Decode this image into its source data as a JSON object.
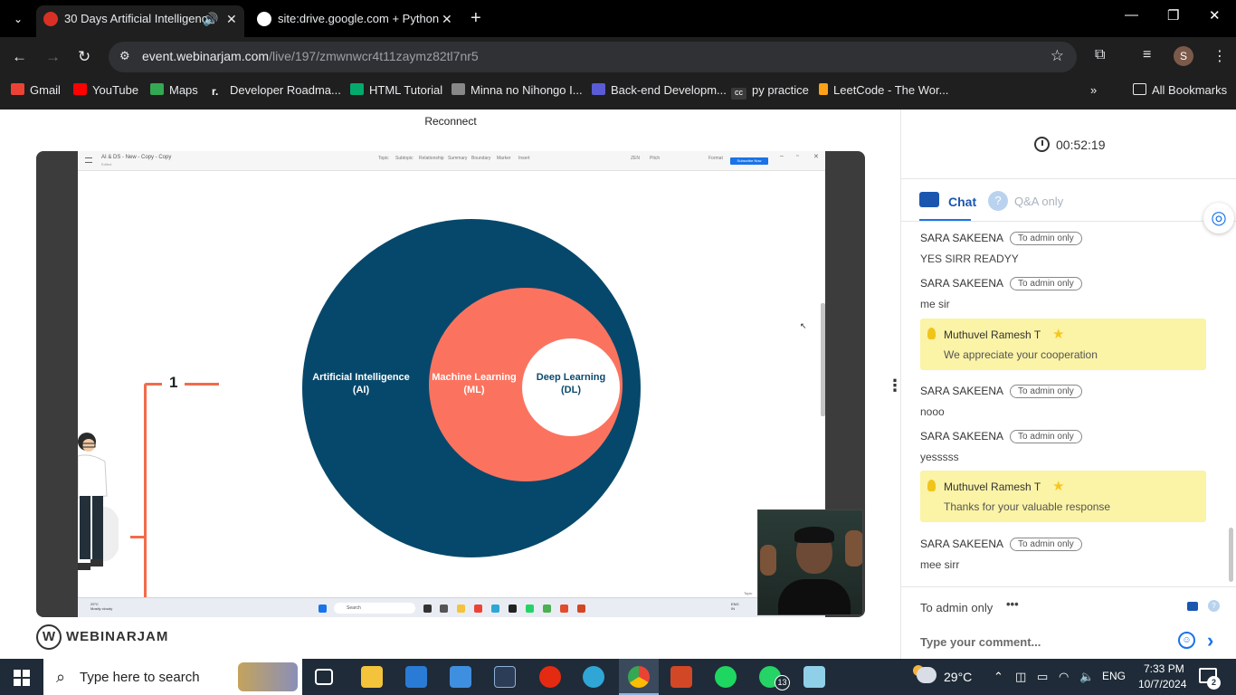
{
  "browser": {
    "tabs": [
      {
        "title": "30 Days Artificial Intelligenc",
        "favicon_color": "#d93025",
        "active": true
      },
      {
        "title": "site:drive.google.com + Python",
        "favicon_color": "#4285f4",
        "active": false
      }
    ],
    "new_tab": "+",
    "url_host": "event.webinarjam.com",
    "url_path": "/live/197/zmwnwcr4t11zaymz82tl7nr5",
    "avatar_letter": "S",
    "bookmarks": [
      {
        "label": "Gmail",
        "color": "#ea4335"
      },
      {
        "label": "YouTube",
        "color": "#ff0000"
      },
      {
        "label": "Maps",
        "color": "#34a853"
      },
      {
        "label": "Developer Roadma...",
        "color": "#e8eaed"
      },
      {
        "label": "HTML Tutorial",
        "color": "#04aa6d"
      },
      {
        "label": "Minna no Nihongo I...",
        "color": "#888888"
      },
      {
        "label": "Back-end Developm...",
        "color": "#5b5bd6"
      },
      {
        "label": "py practice",
        "color": "#e8eaed"
      },
      {
        "label": "LeetCode - The Wor...",
        "color": "#ffa116"
      }
    ],
    "all_bookmarks": "All Bookmarks"
  },
  "webinar": {
    "reconnect_label": "Reconnect",
    "shared_screen": {
      "doc_title": "AI & DS - New - Copy - Copy",
      "doc_sub": "Edited",
      "toolbar": [
        "Topic",
        "Subtopic",
        "Relationship",
        "Summary",
        "Boundary",
        "Marker",
        "Insert"
      ],
      "zen": "ZEN",
      "pitch": "Pitch",
      "format": "Format",
      "subscribe": "Subscribe Now",
      "step_number": "1",
      "venn": {
        "outer": {
          "label": "Artificial Intelligence\n(AI)",
          "color": "#06486b"
        },
        "middle": {
          "label": "Machine Learning\n(ML)",
          "color": "#fb735f"
        },
        "inner": {
          "label": "Deep Learning\n(DL)",
          "color": "#ffffff"
        }
      },
      "mini_taskbar": {
        "temp": "29°C",
        "weather": "Mostly cloudy",
        "search": "Search",
        "lang": "ENG",
        "region": "IN",
        "topic_label": "Topic"
      }
    },
    "brand": "WEBINARJAM",
    "brand_mark": "W"
  },
  "chat": {
    "timer": "00:52:19",
    "tab_chat": "Chat",
    "tab_qa": "Q&A only",
    "qa_icon": "?",
    "messages": [
      {
        "type": "user",
        "name": "SARA SAKEENA",
        "badge": "To admin only",
        "text": "YES SIRR READYY"
      },
      {
        "type": "user",
        "name": "SARA SAKEENA",
        "badge": "To admin only",
        "text": "me sir"
      },
      {
        "type": "host",
        "name": "Muthuvel Ramesh T",
        "text": "We appreciate your cooperation"
      },
      {
        "type": "user",
        "name": "SARA SAKEENA",
        "badge": "To admin only",
        "text": "nooo"
      },
      {
        "type": "user",
        "name": "SARA SAKEENA",
        "badge": "To admin only",
        "text": "yesssss"
      },
      {
        "type": "host",
        "name": "Muthuvel Ramesh T",
        "text": "Thanks for your valuable response"
      },
      {
        "type": "user",
        "name": "SARA SAKEENA",
        "badge": "To admin only",
        "text": "mee sirr"
      }
    ],
    "audience": "To admin only",
    "audience_more": "•••",
    "comment_placeholder": "Type your comment..."
  },
  "taskbar": {
    "search_placeholder": "Type here to search",
    "apps": [
      {
        "name": "task-view",
        "color": "#ffffff"
      },
      {
        "name": "file-explorer",
        "color": "#f3c33b"
      },
      {
        "name": "microsoft-store",
        "color": "#2a7bd6"
      },
      {
        "name": "mail",
        "color": "#3f8fe0"
      },
      {
        "name": "terminal",
        "color": "#2b3d57"
      },
      {
        "name": "record",
        "color": "#e52a12"
      },
      {
        "name": "edge",
        "color": "#2fa6d6"
      },
      {
        "name": "chrome",
        "color": "#ea4335"
      },
      {
        "name": "powerpoint",
        "color": "#d24726"
      },
      {
        "name": "spotify",
        "color": "#1ed760"
      },
      {
        "name": "whatsapp",
        "color": "#25d366"
      },
      {
        "name": "notepad",
        "color": "#8fd0e8"
      }
    ],
    "whatsapp_badge": "13",
    "temperature": "29°C",
    "language": "ENG",
    "time": "7:33 PM",
    "date": "10/7/2024",
    "notifications": "2"
  }
}
